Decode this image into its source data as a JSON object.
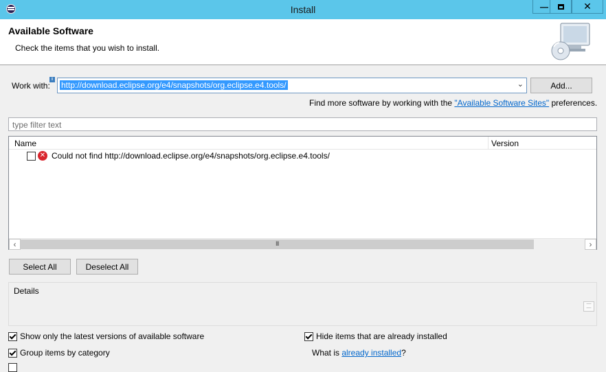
{
  "window": {
    "title": "Install"
  },
  "header": {
    "title": "Available Software",
    "description": "Check the items that you wish to install."
  },
  "work_with": {
    "label": "Work with:",
    "value": "http://download.eclipse.org/e4/snapshots/org.eclipse.e4.tools/",
    "add_label": "Add..."
  },
  "find_more": {
    "prefix": "Find more software by working with the ",
    "link": "\"Available Software Sites\"",
    "suffix": " preferences."
  },
  "filter": {
    "placeholder": "type filter text"
  },
  "tree": {
    "columns": [
      "Name",
      "Version"
    ],
    "rows": [
      {
        "text": "Could not find http://download.eclipse.org/e4/snapshots/org.eclipse.e4.tools/",
        "checked": false,
        "status": "error-icon"
      }
    ],
    "scroll_grip": "III"
  },
  "buttons": {
    "select_all": "Select All",
    "deselect_all": "Deselect All"
  },
  "details": {
    "label": "Details"
  },
  "options": {
    "show_latest": {
      "label": "Show only the latest versions of available software",
      "checked": true
    },
    "hide_installed": {
      "label": "Hide items that are already installed",
      "checked": true
    },
    "group_by_category": {
      "label": "Group items by category",
      "checked": true
    },
    "what_is": {
      "prefix": "What is ",
      "link": "already installed",
      "suffix": "?"
    }
  },
  "colors": {
    "titlebar": "#5bc6ea",
    "selection": "#3399ff",
    "link": "#0066cc",
    "error": "#d9252d"
  }
}
